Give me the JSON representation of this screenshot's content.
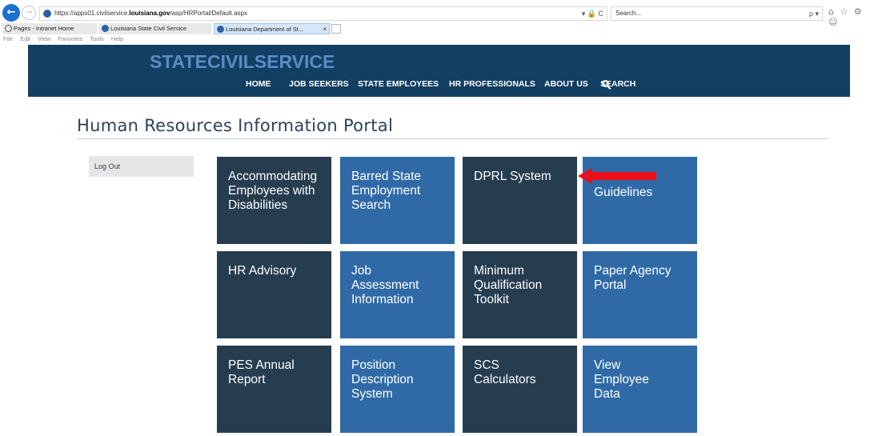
{
  "browser": {
    "url_prefix": "https://apps01.civilservice.",
    "url_domain": "louisiana.gov",
    "url_path": "/asp/HRPortal/Default.aspx",
    "url_tools": "▾ 🔒 C",
    "search_placeholder": "Search...",
    "search_drop": "ρ ▾",
    "window_controls": "— ❐ ✕",
    "right_icons": "⌂ ☆ ⚙ ☺",
    "tabs": [
      {
        "label": "Pages - Intranet Home"
      },
      {
        "label": "Louisiana State Civil Service"
      },
      {
        "label": "Louisiana Department of St...",
        "close": "×"
      }
    ],
    "menu": [
      "File",
      "Edit",
      "View",
      "Favorites",
      "Tools",
      "Help"
    ]
  },
  "site": {
    "logo_part1": "STATE",
    "logo_part2": "CIVIL",
    "logo_part3": "SERVICE",
    "nav": [
      "HOME",
      "JOB SEEKERS",
      "STATE EMPLOYEES",
      "HR PROFESSIONALS",
      "ABOUT US",
      "SEARCH"
    ]
  },
  "page": {
    "title": "Human Resources Information Portal",
    "logout": "Log Out"
  },
  "tiles": [
    {
      "label": "Accommodating\nEmployees with\nDisabilities",
      "style": "dark"
    },
    {
      "label": "Barred State\nEmployment\nSearch",
      "style": "blue"
    },
    {
      "label": "DPRL System",
      "style": "dark"
    },
    {
      "label": "Guidelines",
      "style": "blue"
    },
    {
      "label": "HR Advisory",
      "style": "dark"
    },
    {
      "label": "Job\nAssessment\nInformation",
      "style": "blue"
    },
    {
      "label": "Minimum\nQualification\nToolkit",
      "style": "dark"
    },
    {
      "label": "Paper Agency\nPortal",
      "style": "blue"
    },
    {
      "label": "PES Annual\nReport",
      "style": "dark"
    },
    {
      "label": "Position\nDescription\nSystem",
      "style": "blue"
    },
    {
      "label": "SCS\nCalculators",
      "style": "dark"
    },
    {
      "label": "View\nEmployee\nData",
      "style": "blue"
    }
  ],
  "colors": {
    "header_bg": "#123f62",
    "tile_dark": "#263c4f",
    "tile_blue": "#2f6aa6",
    "arrow": "#e8101a"
  }
}
